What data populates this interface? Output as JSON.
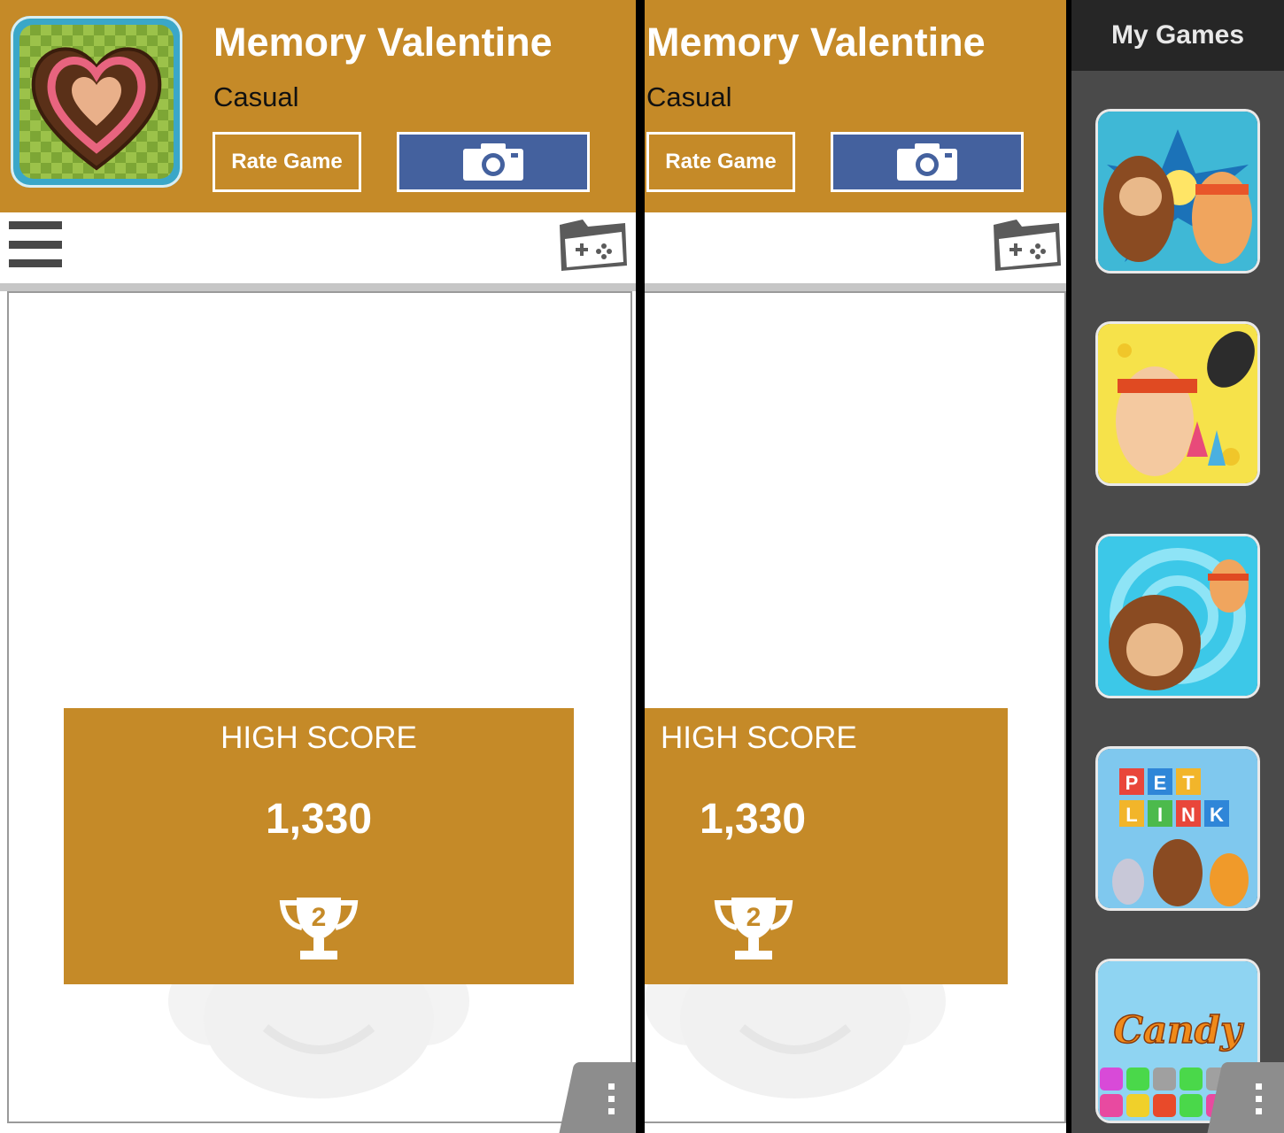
{
  "game": {
    "title": "Memory Valentine",
    "category": "Casual",
    "rate_label": "Rate Game"
  },
  "high_score": {
    "label": "HIGH SCORE",
    "value": "1,330",
    "rank": "2"
  },
  "sidebar": {
    "title": "My Games",
    "games": [
      {
        "icon": "monkey-vs-rabbit-icon"
      },
      {
        "icon": "ninja-rabbit-rockets-icon"
      },
      {
        "icon": "monkey-and-rabbit-spiral-icon"
      },
      {
        "icon": "pet-link-icon",
        "tile_letters": [
          "P",
          "E",
          "T",
          "L",
          "I",
          "N",
          "K"
        ]
      },
      {
        "icon": "candy-icon",
        "logo_text": "Candy"
      }
    ]
  },
  "colors": {
    "header": "#c58a28",
    "camera_button": "#44619e",
    "sidebar_bg": "#4a4a4a",
    "sidebar_header": "#262626"
  }
}
